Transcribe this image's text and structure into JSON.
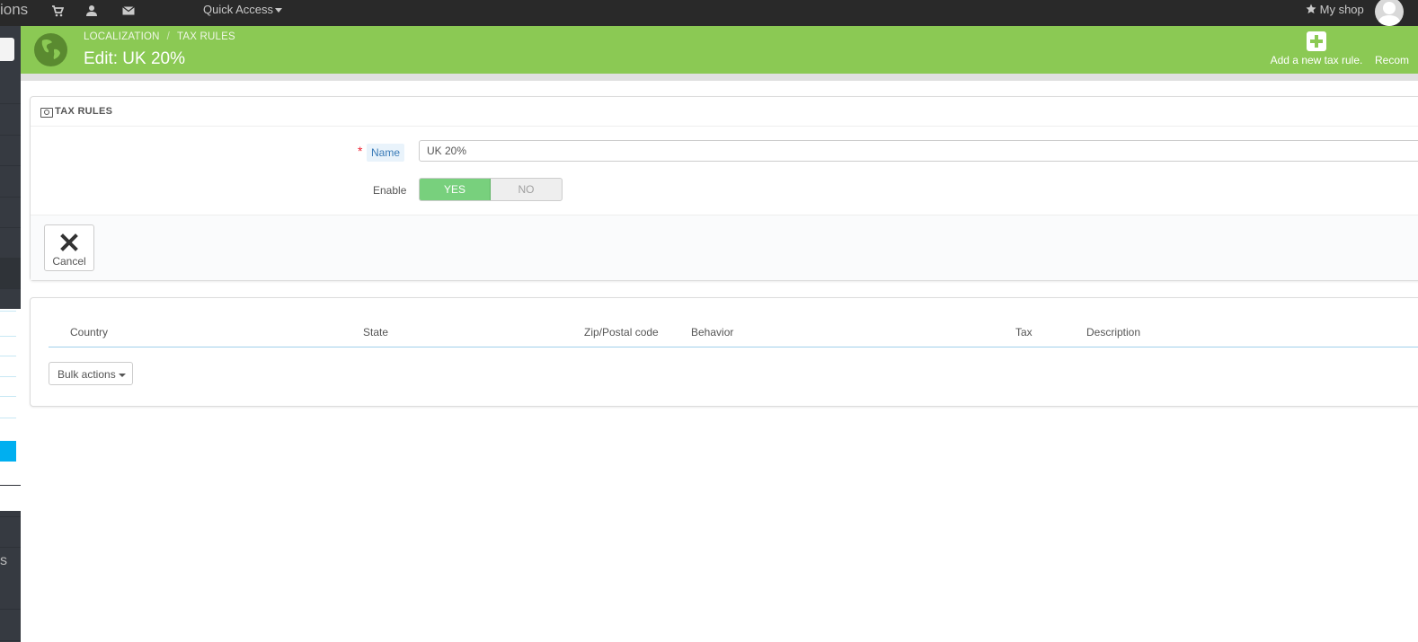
{
  "topbar": {
    "brand_partial": "ions",
    "quick_access": "Quick Access",
    "my_shop": "My shop",
    "icons": [
      "cart-icon",
      "user-icon",
      "envelope-icon",
      "star-icon"
    ]
  },
  "sidebar": {
    "partial_letter": "s"
  },
  "header": {
    "breadcrumb": [
      "LOCALIZATION",
      "TAX RULES"
    ],
    "title": "Edit: UK 20%",
    "add_button": "Add a new tax rule.",
    "recommended_partial": "Recom",
    "accent_color": "#8bc954"
  },
  "form": {
    "caption": "TAX RULES",
    "name_label": "Name",
    "required_mark": "*",
    "name_value": "UK 20%",
    "enable_label": "Enable",
    "toggle_yes": "YES",
    "toggle_no": "NO",
    "enabled": true,
    "cancel_label": "Cancel"
  },
  "table": {
    "columns": [
      "Country",
      "State",
      "Zip/Postal code",
      "Behavior",
      "Tax",
      "Description"
    ],
    "rows": [],
    "bulk_actions": "Bulk actions"
  }
}
